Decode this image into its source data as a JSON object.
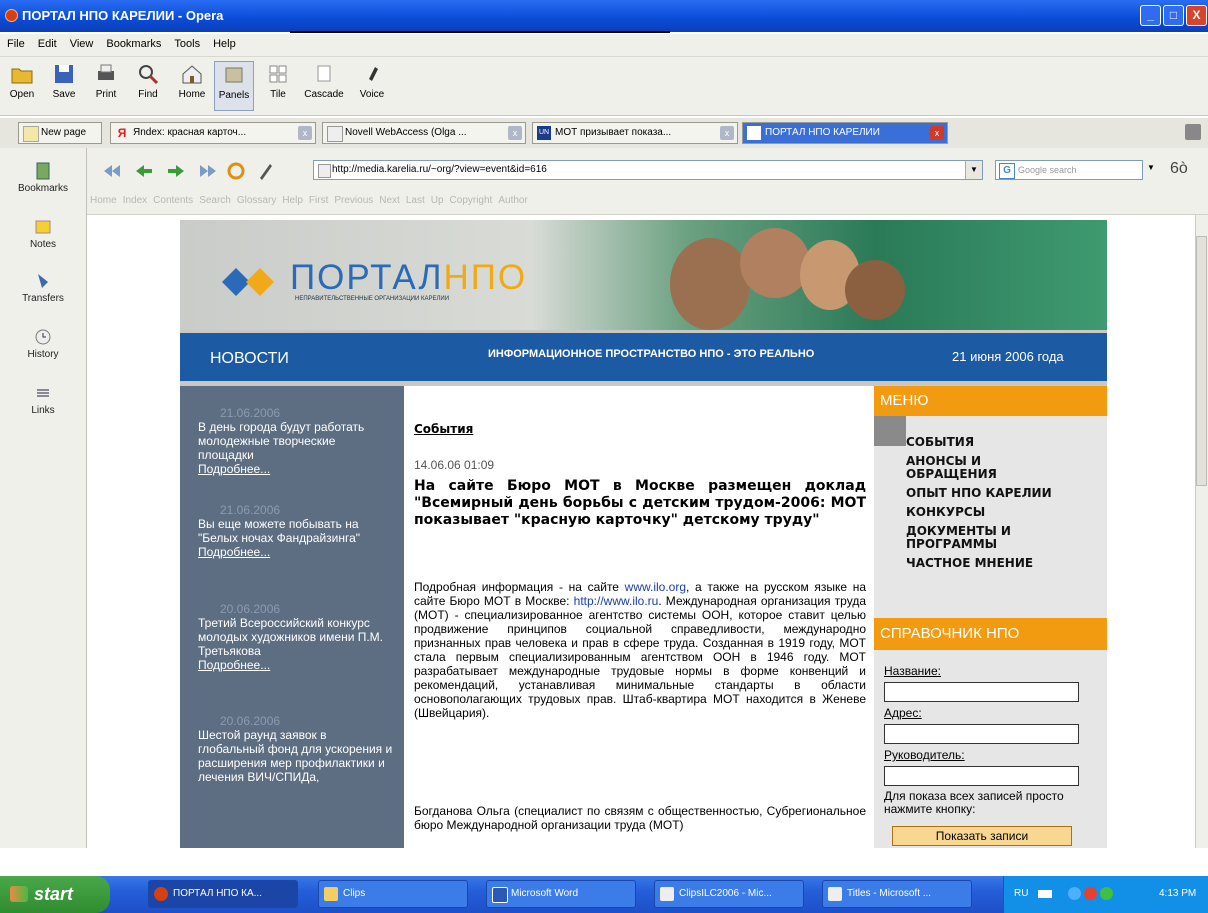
{
  "window": {
    "title": "ПОРТАЛ НПО КАРЕЛИИ - Opera",
    "buttons": [
      "_",
      "□",
      "X"
    ]
  },
  "menu": [
    "File",
    "Edit",
    "View",
    "Bookmarks",
    "Tools",
    "Help"
  ],
  "toolbar": [
    {
      "label": "Open",
      "icon": "folder-icon"
    },
    {
      "label": "Save",
      "icon": "floppy-icon"
    },
    {
      "label": "Print",
      "icon": "printer-icon"
    },
    {
      "label": "Find",
      "icon": "magnifier-icon"
    },
    {
      "label": "Home",
      "icon": "house-icon"
    },
    {
      "label": "Panels",
      "icon": "panels-icon"
    },
    {
      "label": "Tile",
      "icon": "tile-icon"
    },
    {
      "label": "Cascade",
      "icon": "cascade-icon"
    },
    {
      "label": "Voice",
      "icon": "microphone-icon"
    }
  ],
  "tabs": [
    {
      "label": "New page"
    },
    {
      "label": "Яndex: красная карточ..."
    },
    {
      "label": "Novell WebAccess (Olga ..."
    },
    {
      "label": "МОТ призывает показа..."
    },
    {
      "label": "ПОРТАЛ НПО КАРЕЛИИ"
    }
  ],
  "side_panel": [
    "Bookmarks",
    "Notes",
    "Transfers",
    "History",
    "Links"
  ],
  "address": {
    "url": "http://media.karelia.ru/~org/?view=event&id=616",
    "search_placeholder": "Google search"
  },
  "nav_links": [
    "Home",
    "Index",
    "Contents",
    "Search",
    "Glossary",
    "Help",
    "First",
    "Previous",
    "Next",
    "Last",
    "Up",
    "Copyright",
    "Author"
  ],
  "site": {
    "logo_main": "ПОРТАЛ",
    "logo_accent": "НПО",
    "logo_sub": "НЕПРАВИТЕЛЬСТВЕННЫЕ ОРГАНИЗАЦИИ КАРЕЛИИ",
    "news_heading": "НОВОСТИ",
    "slogan": "ИНФОРМАЦИОННОЕ ПРОСТРАНСТВО НПО - ЭТО РЕАЛЬНО",
    "date": "21 июня 2006 года",
    "news": [
      {
        "date": "21.06.2006",
        "text": "В день города будут работать молодежные творческие площадки",
        "more": "Подробнее..."
      },
      {
        "date": "21.06.2006",
        "text": "Вы еще можете побывать на \"Белых ночах Фандрайзинга\"",
        "more": "Подробнее..."
      },
      {
        "date": "20.06.2006",
        "text": "Третий Всероссийский конкурс молодых художников имени П.М. Третьякова",
        "more": "Подробнее..."
      },
      {
        "date": "20.06.2006",
        "text": "Шестой раунд заявок в глобальный фонд для ускорения и расширения мер профилактики и лечения ВИЧ/СПИДа,",
        "more": ""
      }
    ],
    "article": {
      "section": "События",
      "timestamp": "14.06.06 01:09",
      "headline": "На сайте Бюро МОТ в Москве размещен доклад \"Всемирный день борьбы с детским трудом-2006: МОТ показывает \"красную карточку\" детскому труду\"",
      "p1_a": "Подробная информация - на сайте ",
      "link1": "www.ilo.org",
      "p1_b": ", а также на русском языке на сайте Бюро МОТ в Москве: ",
      "link2": "http://www.ilo.ru",
      "p1_c": ". Международная организация труда (МОТ) - специализированное агентство системы ООН, которое ставит целью продвижение принципов социальной справедливости, международно признанных прав человека и прав в сфере труда. Созданная в 1919 году, МОТ стала первым специализированным агентством ООН в 1946 году. МОТ разрабатывает международные трудовые нормы в форме конвенций и рекомендаций, устанавливая минимальные стандарты в области основополагающих трудовых прав. Штаб-квартира МОТ находится в Женеве (Швейцария).",
      "p2": "Богданова Ольга (специалист по связям с общественностью, Субрегиональное бюро Международной организации труда (МОТ)"
    },
    "menu_heading": "МЕНЮ",
    "menu_items": [
      "СОБЫТИЯ",
      "АНОНСЫ И ОБРАЩЕНИЯ",
      "ОПЫТ НПО КАРЕЛИИ",
      "КОНКУРСЫ",
      "ДОКУМЕНТЫ И ПРОГРАММЫ",
      "ЧАСТНОЕ МНЕНИЕ"
    ],
    "ref_heading": "СПРАВОЧНИК НПО",
    "form": {
      "name_label": "Название:",
      "address_label": "Адрес:",
      "head_label": "Руководитель:",
      "note": "Для показа всех записей просто нажмите кнопку:",
      "button": "Показать записи"
    }
  },
  "taskbar": {
    "start": "start",
    "tasks": [
      "ПОРТАЛ НПО КА...",
      "Clips",
      "Microsoft Word",
      "ClipsILC2006 - Mic...",
      "Titles - Microsoft ..."
    ],
    "lang": "RU",
    "time": "4:13 PM"
  },
  "colors": {
    "brand_blue": "#1c5aa4",
    "brand_orange": "#f29a10",
    "sidebar_slate": "#5d6e83"
  }
}
